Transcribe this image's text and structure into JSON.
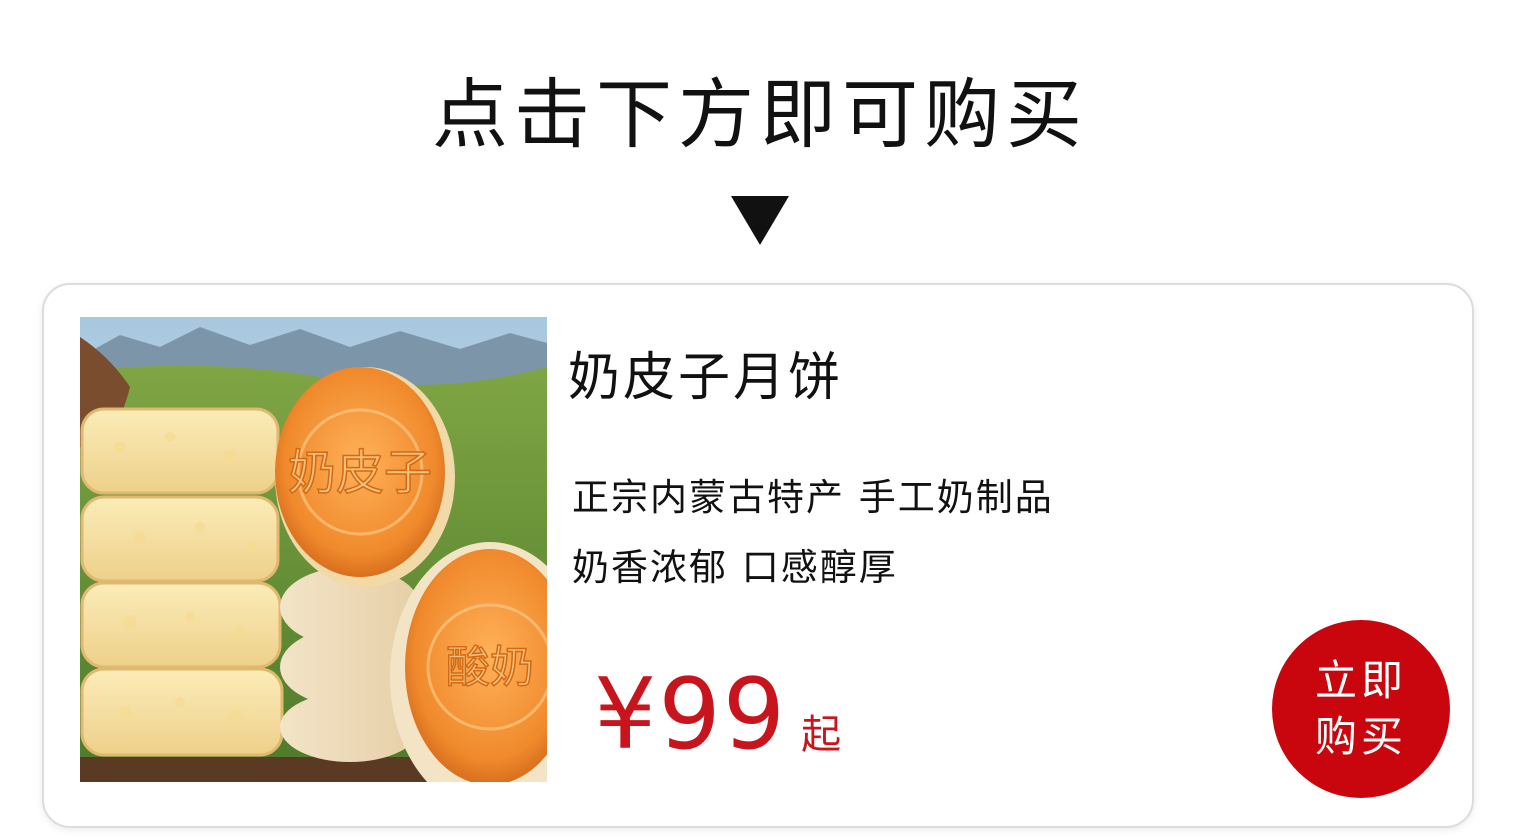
{
  "header": {
    "title": "点击下方即可购买",
    "arrow_icon": "down-triangle-icon"
  },
  "product": {
    "name": "奶皮子月饼",
    "description_lines": [
      "正宗内蒙古特产 手工奶制品",
      "奶香浓郁 口感醇厚"
    ],
    "price": "¥99",
    "price_suffix": "起",
    "price_color": "#c8141c",
    "image_stamp_text": [
      "奶皮子",
      "酸奶"
    ]
  },
  "buy_button": {
    "line1": "立即",
    "line2": "购买",
    "color": "#c9050d"
  }
}
